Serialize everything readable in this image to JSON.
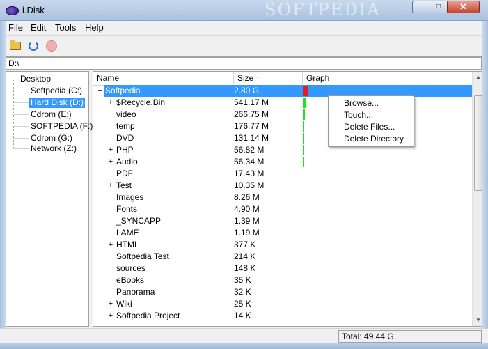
{
  "window": {
    "title": "i.Disk",
    "watermark": "SOFTPEDIA",
    "minimize": "−",
    "maximize": "□",
    "close": "✕"
  },
  "menu": [
    "File",
    "Edit",
    "Tools",
    "Help"
  ],
  "toolbar": {
    "icons": [
      "open-folder-icon",
      "refresh-icon",
      "stop-icon"
    ]
  },
  "path": "D:\\",
  "tree": [
    {
      "label": "Desktop",
      "selected": false
    },
    {
      "label": "Softpedia (C:)",
      "selected": false
    },
    {
      "label": "Hard Disk (D:)",
      "selected": true
    },
    {
      "label": "Cdrom (E:)",
      "selected": false
    },
    {
      "label": "SOFTPEDIA (F:)",
      "selected": false
    },
    {
      "label": "Cdrom (G:)",
      "selected": false
    },
    {
      "label": "Network (Z:)",
      "selected": false
    }
  ],
  "columns": {
    "name": "Name",
    "size": "Size ↑",
    "graph": "Graph"
  },
  "rows": [
    {
      "expander": "−",
      "name": "Softpedia",
      "size": "2.80 G",
      "graph": 1.0,
      "selected": true,
      "level": 0
    },
    {
      "expander": "+",
      "name": "$Recycle.Bin",
      "size": "541.17 M",
      "graph": 0.19,
      "level": 1
    },
    {
      "expander": "",
      "name": "video",
      "size": "266.75 M",
      "graph": 0.093,
      "level": 1
    },
    {
      "expander": "",
      "name": "temp",
      "size": "176.77 M",
      "graph": 0.062,
      "level": 1
    },
    {
      "expander": "",
      "name": "DVD",
      "size": "131.14 M",
      "graph": 0.046,
      "level": 1
    },
    {
      "expander": "+",
      "name": "PHP",
      "size": "56.82 M",
      "graph": 0.02,
      "level": 1
    },
    {
      "expander": "+",
      "name": "Audio",
      "size": "56.34 M",
      "graph": 0.02,
      "level": 1
    },
    {
      "expander": "",
      "name": "PDF",
      "size": "17.43 M",
      "graph": 0,
      "level": 1
    },
    {
      "expander": "+",
      "name": "Test",
      "size": "10.35 M",
      "graph": 0,
      "level": 1
    },
    {
      "expander": "",
      "name": "Images",
      "size": "8.26 M",
      "graph": 0,
      "level": 1
    },
    {
      "expander": "",
      "name": "Fonts",
      "size": "4.90 M",
      "graph": 0,
      "level": 1
    },
    {
      "expander": "",
      "name": "_SYNCAPP",
      "size": "1.39 M",
      "graph": 0,
      "level": 1
    },
    {
      "expander": "",
      "name": "LAME",
      "size": "1.19 M",
      "graph": 0,
      "level": 1
    },
    {
      "expander": "+",
      "name": "HTML",
      "size": "377 K",
      "graph": 0,
      "level": 1
    },
    {
      "expander": "",
      "name": "Softpedia Test",
      "size": "214 K",
      "graph": 0,
      "level": 1
    },
    {
      "expander": "",
      "name": "sources",
      "size": "148 K",
      "graph": 0,
      "level": 1
    },
    {
      "expander": "",
      "name": "eBooks",
      "size": "35 K",
      "graph": 0,
      "level": 1
    },
    {
      "expander": "",
      "name": "Panorama",
      "size": "32 K",
      "graph": 0,
      "level": 1
    },
    {
      "expander": "+",
      "name": "Wiki",
      "size": "25 K",
      "graph": 0,
      "level": 1
    },
    {
      "expander": "+",
      "name": "Softpedia Project",
      "size": "14 K",
      "graph": 0,
      "level": 1
    }
  ],
  "context_menu": [
    "Browse...",
    "Touch...",
    "Delete Files...",
    "Delete Directory"
  ],
  "status": {
    "total": "Total: 49.44 G"
  },
  "colors": {
    "selection": "#3399ff",
    "bar": "#19e619",
    "bar_selected": "#e02020"
  }
}
